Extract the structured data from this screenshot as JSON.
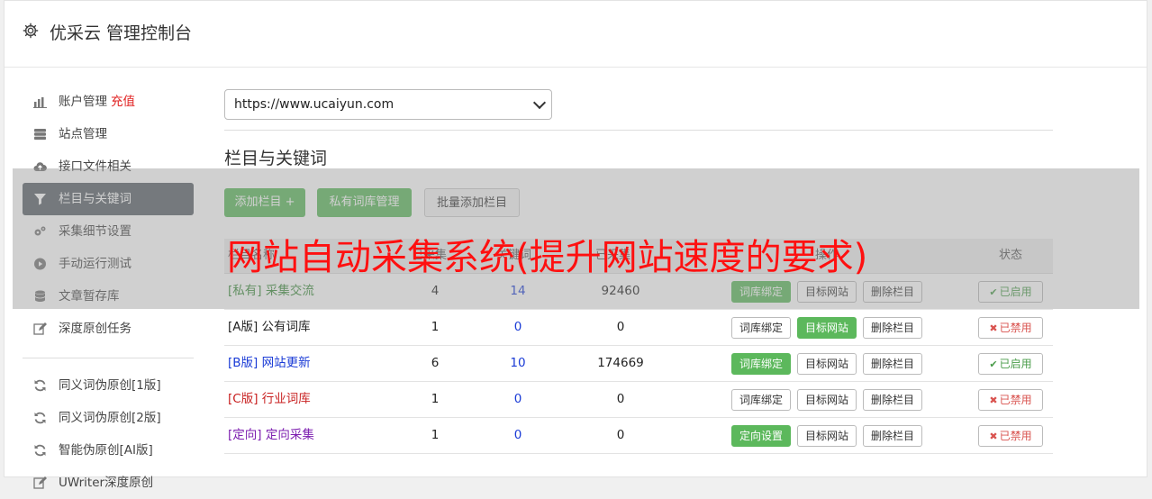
{
  "header": {
    "title": "优采云 管理控制台",
    "icon": "gear-icon"
  },
  "sidebar": {
    "items": [
      {
        "label": "账户管理",
        "extra": "充值",
        "icon": "bar-chart-icon"
      },
      {
        "label": "站点管理",
        "icon": "server-icon"
      },
      {
        "label": "接口文件相关",
        "icon": "cloud-upload-icon"
      },
      {
        "label": "栏目与关键词",
        "icon": "filter-icon",
        "active": true
      },
      {
        "label": "采集细节设置",
        "icon": "cogs-icon"
      },
      {
        "label": "手动运行测试",
        "icon": "play-circle-icon"
      },
      {
        "label": "文章暂存库",
        "icon": "database-icon"
      },
      {
        "label": "深度原创任务",
        "icon": "edit-icon"
      }
    ],
    "items2": [
      {
        "label": "同义词伪原创[1版]",
        "icon": "refresh-icon"
      },
      {
        "label": "同义词伪原创[2版]",
        "icon": "refresh-icon"
      },
      {
        "label": "智能伪原创[AI版]",
        "icon": "refresh-icon"
      },
      {
        "label": "UWriter深度原创",
        "icon": "edit-icon"
      }
    ]
  },
  "site_select": {
    "value": "https://www.ucaiyun.com"
  },
  "section": {
    "title": "栏目与关键词"
  },
  "toolbar": {
    "add_column": "添加栏目 +",
    "private_lib": "私有词库管理",
    "batch_add": "批量添加栏目"
  },
  "table": {
    "headers": [
      "栏目名称",
      "已采集",
      "关键词",
      "已采集",
      "操作",
      "状态"
    ],
    "rows": [
      {
        "name": "[私有] 采集交流",
        "a": "4",
        "b": "14",
        "c": "92460",
        "op1": "词库绑定",
        "op2": "目标网站",
        "op3": "删除栏目",
        "status": "已启用",
        "on": true,
        "color": "green",
        "op1_green": true,
        "op2_green": false
      },
      {
        "name": "[A版] 公有词库",
        "a": "1",
        "b": "0",
        "c": "0",
        "op1": "词库绑定",
        "op2": "目标网站",
        "op3": "删除栏目",
        "status": "已禁用",
        "on": false,
        "color": "dark",
        "op1_green": false,
        "op2_green": true
      },
      {
        "name": "[B版] 网站更新",
        "a": "6",
        "b": "10",
        "c": "174669",
        "op1": "词库绑定",
        "op2": "目标网站",
        "op3": "删除栏目",
        "status": "已启用",
        "on": true,
        "color": "blue",
        "op1_green": true,
        "op2_green": false
      },
      {
        "name": "[C版] 行业词库",
        "a": "1",
        "b": "0",
        "c": "0",
        "op1": "词库绑定",
        "op2": "目标网站",
        "op3": "删除栏目",
        "status": "已禁用",
        "on": false,
        "color": "red",
        "op1_green": false,
        "op2_green": false
      },
      {
        "name": "[定向] 定向采集",
        "a": "1",
        "b": "0",
        "c": "0",
        "op1": "定向设置",
        "op2": "目标网站",
        "op3": "删除栏目",
        "status": "已禁用",
        "on": false,
        "color": "purple",
        "op1_green": true,
        "op2_green": false
      }
    ]
  },
  "overlay": {
    "text": "网站自动采集系统(提升网站速度的要求)"
  }
}
